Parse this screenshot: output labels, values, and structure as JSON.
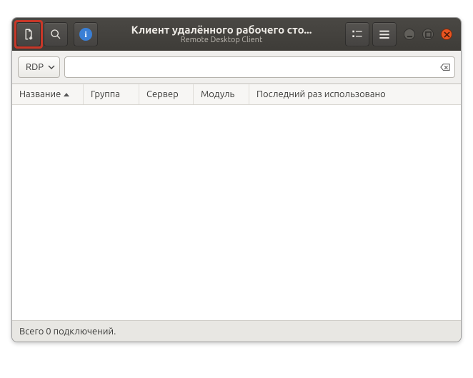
{
  "header": {
    "title": "Клиент удалённого рабочего сто...",
    "subtitle": "Remote Desktop Client"
  },
  "toolbar": {
    "protocol": "RDP",
    "address_value": ""
  },
  "columns": {
    "name": "Название",
    "group": "Группа",
    "server": "Сервер",
    "plugin": "Модуль",
    "last": "Последний раз использовано"
  },
  "status": {
    "text": "Всего 0 подключений."
  }
}
